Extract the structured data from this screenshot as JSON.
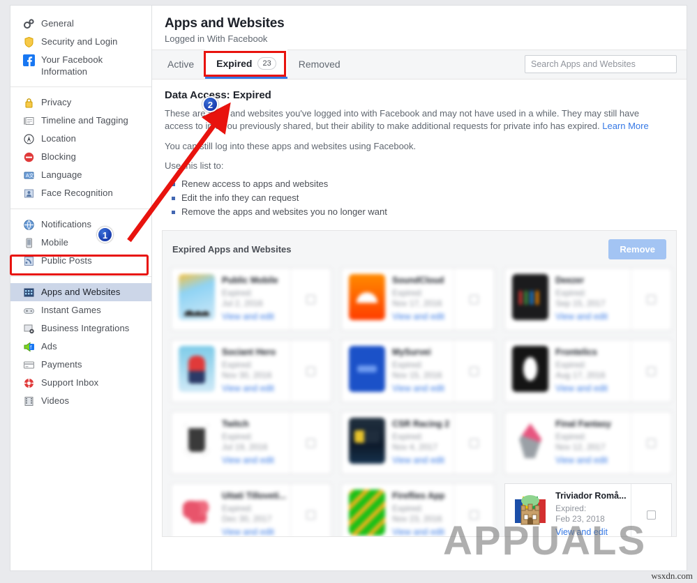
{
  "sidebar": {
    "groups": [
      {
        "items": [
          {
            "label": "General",
            "icon": "gears-icon",
            "selected": false
          },
          {
            "label": "Security and Login",
            "icon": "shield-icon",
            "selected": false
          },
          {
            "label": "Your Facebook Information",
            "icon": "facebook-icon",
            "selected": false
          }
        ]
      },
      {
        "items": [
          {
            "label": "Privacy",
            "icon": "lock-icon",
            "selected": false
          },
          {
            "label": "Timeline and Tagging",
            "icon": "timeline-icon",
            "selected": false
          },
          {
            "label": "Location",
            "icon": "location-icon",
            "selected": false
          },
          {
            "label": "Blocking",
            "icon": "block-icon",
            "selected": false
          },
          {
            "label": "Language",
            "icon": "language-icon",
            "selected": false
          },
          {
            "label": "Face Recognition",
            "icon": "face-icon",
            "selected": false
          }
        ]
      },
      {
        "items": [
          {
            "label": "Notifications",
            "icon": "globe-icon",
            "selected": false
          },
          {
            "label": "Mobile",
            "icon": "mobile-icon",
            "selected": false
          },
          {
            "label": "Public Posts",
            "icon": "rss-icon",
            "selected": false
          }
        ]
      },
      {
        "items": [
          {
            "label": "Apps and Websites",
            "icon": "apps-icon",
            "selected": true
          },
          {
            "label": "Instant Games",
            "icon": "gamepad-icon",
            "selected": false
          },
          {
            "label": "Business Integrations",
            "icon": "briefcase-gear-icon",
            "selected": false
          },
          {
            "label": "Ads",
            "icon": "ads-icon",
            "selected": false
          },
          {
            "label": "Payments",
            "icon": "card-icon",
            "selected": false
          },
          {
            "label": "Support Inbox",
            "icon": "lifebuoy-icon",
            "selected": false
          },
          {
            "label": "Videos",
            "icon": "film-icon",
            "selected": false
          }
        ]
      }
    ]
  },
  "header": {
    "title": "Apps and Websites",
    "subtitle": "Logged in With Facebook"
  },
  "tabs": [
    {
      "label": "Active",
      "count": "",
      "active": false
    },
    {
      "label": "Expired",
      "count": "23",
      "active": true
    },
    {
      "label": "Removed",
      "count": "",
      "active": false
    }
  ],
  "search": {
    "placeholder": "Search Apps and Websites",
    "value": ""
  },
  "body": {
    "data_access_title": "Data Access: Expired",
    "paragraph_1_part1": "These are apps and websites you've logged into with Facebook and may not have used in a while. They may still have access to info you previously shared, but their ability to make additional requests for private info has expired. ",
    "paragraph_1_link": "Learn More",
    "paragraph_2": "You can still log into these apps and websites using Facebook.",
    "use_list_label": "Use this list to:",
    "use_list": [
      "Renew access to apps and websites",
      "Edit the info they can request",
      "Remove the apps and websites you no longer want"
    ]
  },
  "apps_panel": {
    "title": "Expired Apps and Websites",
    "remove_label": "Remove",
    "expired_prefix": "Expired:",
    "view_edit_label": "View and edit",
    "cards": [
      {
        "name": "Public Mobile",
        "expired_label": "Expired:",
        "expired_date": "Jul 2, 2016",
        "link": "View and edit",
        "icon": "ic-photo",
        "focused": false
      },
      {
        "name": "SoundCloud",
        "expired_label": "Expired:",
        "expired_date": "Nov 17, 2016",
        "link": "View and edit",
        "icon": "ic-soundcloud",
        "focused": false
      },
      {
        "name": "Deezer",
        "expired_label": "Expired:",
        "expired_date": "Sep 15, 2017",
        "link": "View and edit",
        "icon": "ic-dark-chart",
        "focused": false
      },
      {
        "name": "Sociant Hero",
        "expired_label": "Expired:",
        "expired_date": "Nov 30, 2016",
        "link": "View and edit",
        "icon": "ic-hero",
        "focused": false
      },
      {
        "name": "MySurvei",
        "expired_label": "Expired:",
        "expired_date": "Nov 15, 2016",
        "link": "View and edit",
        "icon": "ic-blue-app",
        "focused": false
      },
      {
        "name": "Frontelics",
        "expired_label": "Expired:",
        "expired_date": "Aug 17, 2016",
        "link": "View and edit",
        "icon": "ic-dark-oval",
        "focused": false
      },
      {
        "name": "Twitch",
        "expired_label": "Expired:",
        "expired_date": "Jul 19, 2016",
        "link": "View and edit",
        "icon": "ic-twitch",
        "focused": false
      },
      {
        "name": "CSR Racing 2",
        "expired_label": "Expired:",
        "expired_date": "Nov 4, 2017",
        "link": "View and edit",
        "icon": "ic-racing",
        "focused": false
      },
      {
        "name": "Final Fantasy",
        "expired_label": "Expired:",
        "expired_date": "Nov 12, 2017",
        "link": "View and edit",
        "icon": "ic-ff",
        "focused": false
      },
      {
        "name": "Uitati Tilloveti...",
        "expired_label": "Expired:",
        "expired_date": "Dec 30, 2017",
        "link": "View and edit",
        "icon": "ic-red-blob",
        "focused": false
      },
      {
        "name": "Fireflies App",
        "expired_label": "Expired:",
        "expired_date": "Nov 23, 2016",
        "link": "View and edit",
        "icon": "ic-green",
        "focused": false
      },
      {
        "name": "Triviador Romå...",
        "expired_label": "Expired:",
        "expired_date": "Feb 23, 2018",
        "link": "View and edit",
        "icon": "ic-triviador",
        "focused": true
      }
    ]
  },
  "annotations": {
    "badge_1": "1",
    "badge_2": "2",
    "highlight_color": "#e8130e",
    "arrow_color": "#e8130e",
    "badge_color": "#1536a8"
  },
  "watermarks": {
    "overlay": "APPUALS",
    "site": "wsxdn.com"
  }
}
